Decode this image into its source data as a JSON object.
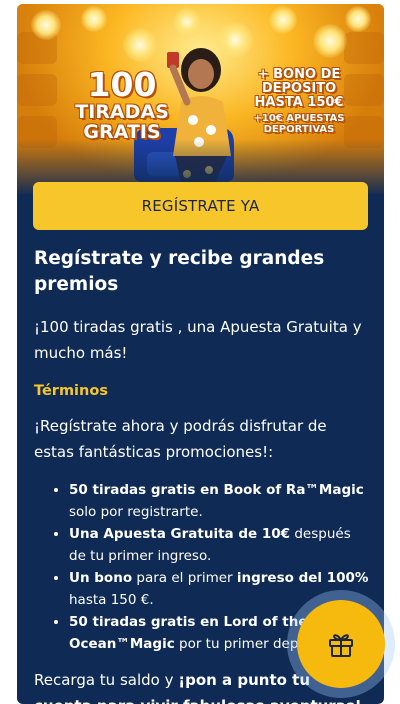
{
  "hero": {
    "promo_left": [
      "100",
      "TIRADAS",
      "GRATIS"
    ],
    "promo_right": [
      "+ BONO DE",
      "DEPÓSITO",
      "HASTA 150€",
      "+10€ APUESTAS",
      "DEPORTIVAS"
    ]
  },
  "cta": {
    "label": "REGÍSTRATE YA"
  },
  "content": {
    "title": "Regístrate y recibe grandes premios",
    "lead": "¡100 tiradas gratis , una Apuesta Gratuita y mucho más!",
    "terms_label": "Términos",
    "intro": "¡Regístrate ahora y podrás disfrutar de estas fantásticas promociones!:",
    "benefits": [
      {
        "bold": "50 tiradas gratis en Book of Ra™Magic",
        "rest": " solo por registrarte."
      },
      {
        "bold": "Una Apuesta Gratuita de 10€",
        "rest": " después de tu primer ingreso."
      },
      {
        "bold": "Un bono",
        "mid": " para el primer ",
        "bold2": "ingreso del 100%",
        "rest": " hasta 150 €."
      },
      {
        "bold": "50 tiradas gratis en Lord of the Ocean™Magic",
        "rest": " por tu primer depósito."
      }
    ],
    "closing_plain": "Recarga tu saldo y ",
    "closing_bold": "¡pon a punto tu cuenta para vivir fabulosas aventuras!"
  },
  "floating": {
    "icon": "gift-icon"
  },
  "colors": {
    "accent": "#f6c62a",
    "background": "#0e2a55",
    "gift_button": "#f6b90e"
  }
}
